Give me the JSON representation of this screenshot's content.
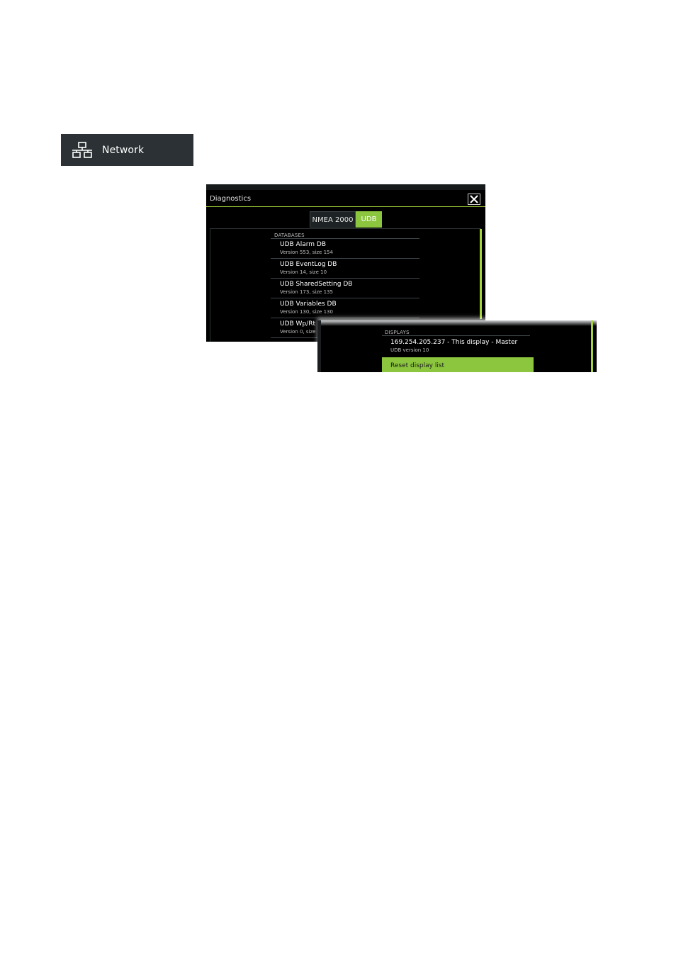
{
  "network_button": {
    "label": "Network",
    "icon": "network-icon"
  },
  "dialog": {
    "title": "Diagnostics",
    "close_icon": "close-icon",
    "tabs": [
      {
        "label": "NMEA 2000",
        "active": false
      },
      {
        "label": "UDB",
        "active": true
      }
    ],
    "databases_header": "DATABASES",
    "databases": [
      {
        "name": "UDB Alarm DB",
        "detail": "Version 553, size 154"
      },
      {
        "name": "UDB EventLog DB",
        "detail": "Version 14, size 10"
      },
      {
        "name": "UDB SharedSetting DB",
        "detail": "Version 173, size 135"
      },
      {
        "name": "UDB Variables DB",
        "detail": "Version 130, size 130"
      },
      {
        "name": "UDB Wp/Rt DB",
        "detail": "Version 0, size 0"
      }
    ]
  },
  "displays_panel": {
    "header": "DISPLAYS",
    "display": {
      "name": "169.254.205.237 - This display - Master",
      "detail": "UDB version 10"
    },
    "reset_label": "Reset display list"
  },
  "colors": {
    "accent": "#8cc63f",
    "dialog_bg": "#000000",
    "button_bg": "#2b3134"
  }
}
